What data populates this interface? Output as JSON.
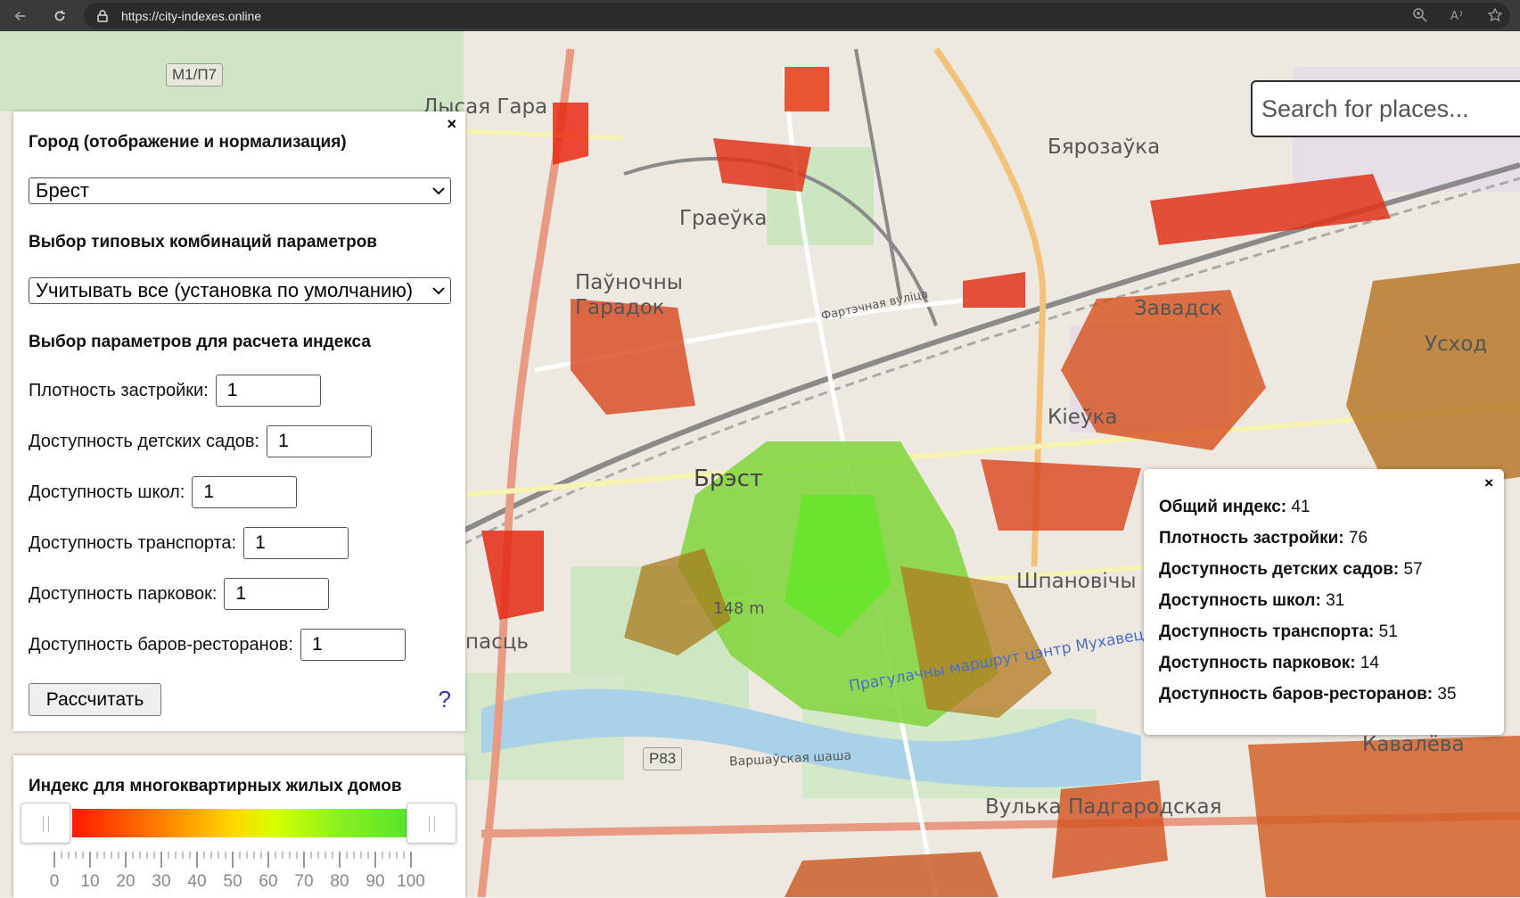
{
  "browser": {
    "url": "https://city-indexes.online"
  },
  "map": {
    "labels": [
      {
        "text": "М1/П7",
        "kind": "shield"
      },
      {
        "text": "Лысая Гара",
        "kind": "place"
      },
      {
        "text": "Бярозаўка",
        "kind": "place"
      },
      {
        "text": "Граеўка",
        "kind": "place"
      },
      {
        "text": "Паўночны Гарадок",
        "kind": "place"
      },
      {
        "text": "Завадск",
        "kind": "place"
      },
      {
        "text": "Усход",
        "kind": "place"
      },
      {
        "text": "Кіеўка",
        "kind": "place"
      },
      {
        "text": "Брэст",
        "kind": "city"
      },
      {
        "text": "Шпановічы",
        "kind": "place"
      },
      {
        "text": "148 m",
        "kind": "place"
      },
      {
        "text": "пасць",
        "kind": "place"
      },
      {
        "text": "Кавалёва",
        "kind": "place"
      },
      {
        "text": "Вулька Падгародская",
        "kind": "place"
      },
      {
        "text": "Р83",
        "kind": "shield"
      },
      {
        "text": "Варшаўская шаша",
        "kind": "road"
      },
      {
        "text": "Фартэчная вуліца",
        "kind": "road"
      },
      {
        "text": "Прагулачны маршрут цэнтр Мухавец",
        "kind": "road"
      }
    ],
    "search": {
      "placeholder": "Search for places..."
    }
  },
  "panel": {
    "close": "×",
    "city_heading": "Город (отображение и нормализация)",
    "city_selected": "Брест",
    "combo_heading": "Выбор типовых комбинаций параметров",
    "combo_selected": "Учитывать все (установка по умолчанию)",
    "params_heading": "Выбор параметров для расчета индекса",
    "params": [
      {
        "label": "Плотность застройки:",
        "value": "1"
      },
      {
        "label": "Доступность детских садов:",
        "value": "1"
      },
      {
        "label": "Доступность школ:",
        "value": "1"
      },
      {
        "label": "Доступность транспорта:",
        "value": "1"
      },
      {
        "label": "Доступность парковок:",
        "value": "1"
      },
      {
        "label": "Доступность баров-ресторанов:",
        "value": "1"
      }
    ],
    "calculate": "Рассчитать",
    "help": "?"
  },
  "legend": {
    "title": "Индекс для многоквартирных жилых домов",
    "range": [
      0,
      100
    ],
    "tick_labels": [
      "0",
      "10",
      "20",
      "30",
      "40",
      "50",
      "60",
      "70",
      "80",
      "90",
      "100"
    ],
    "colors": {
      "low": "#ff1a00",
      "mid": "#ffd800",
      "high": "#56e52c"
    }
  },
  "info": {
    "close": "×",
    "rows": [
      {
        "label": "Общий индекс:",
        "value": "41"
      },
      {
        "label": "Плотность застройки:",
        "value": "76"
      },
      {
        "label": "Доступность детских садов:",
        "value": "57"
      },
      {
        "label": "Доступность школ:",
        "value": "31"
      },
      {
        "label": "Доступность транспорта:",
        "value": "51"
      },
      {
        "label": "Доступность парковок:",
        "value": "14"
      },
      {
        "label": "Доступность баров-ресторанов:",
        "value": "35"
      }
    ]
  }
}
